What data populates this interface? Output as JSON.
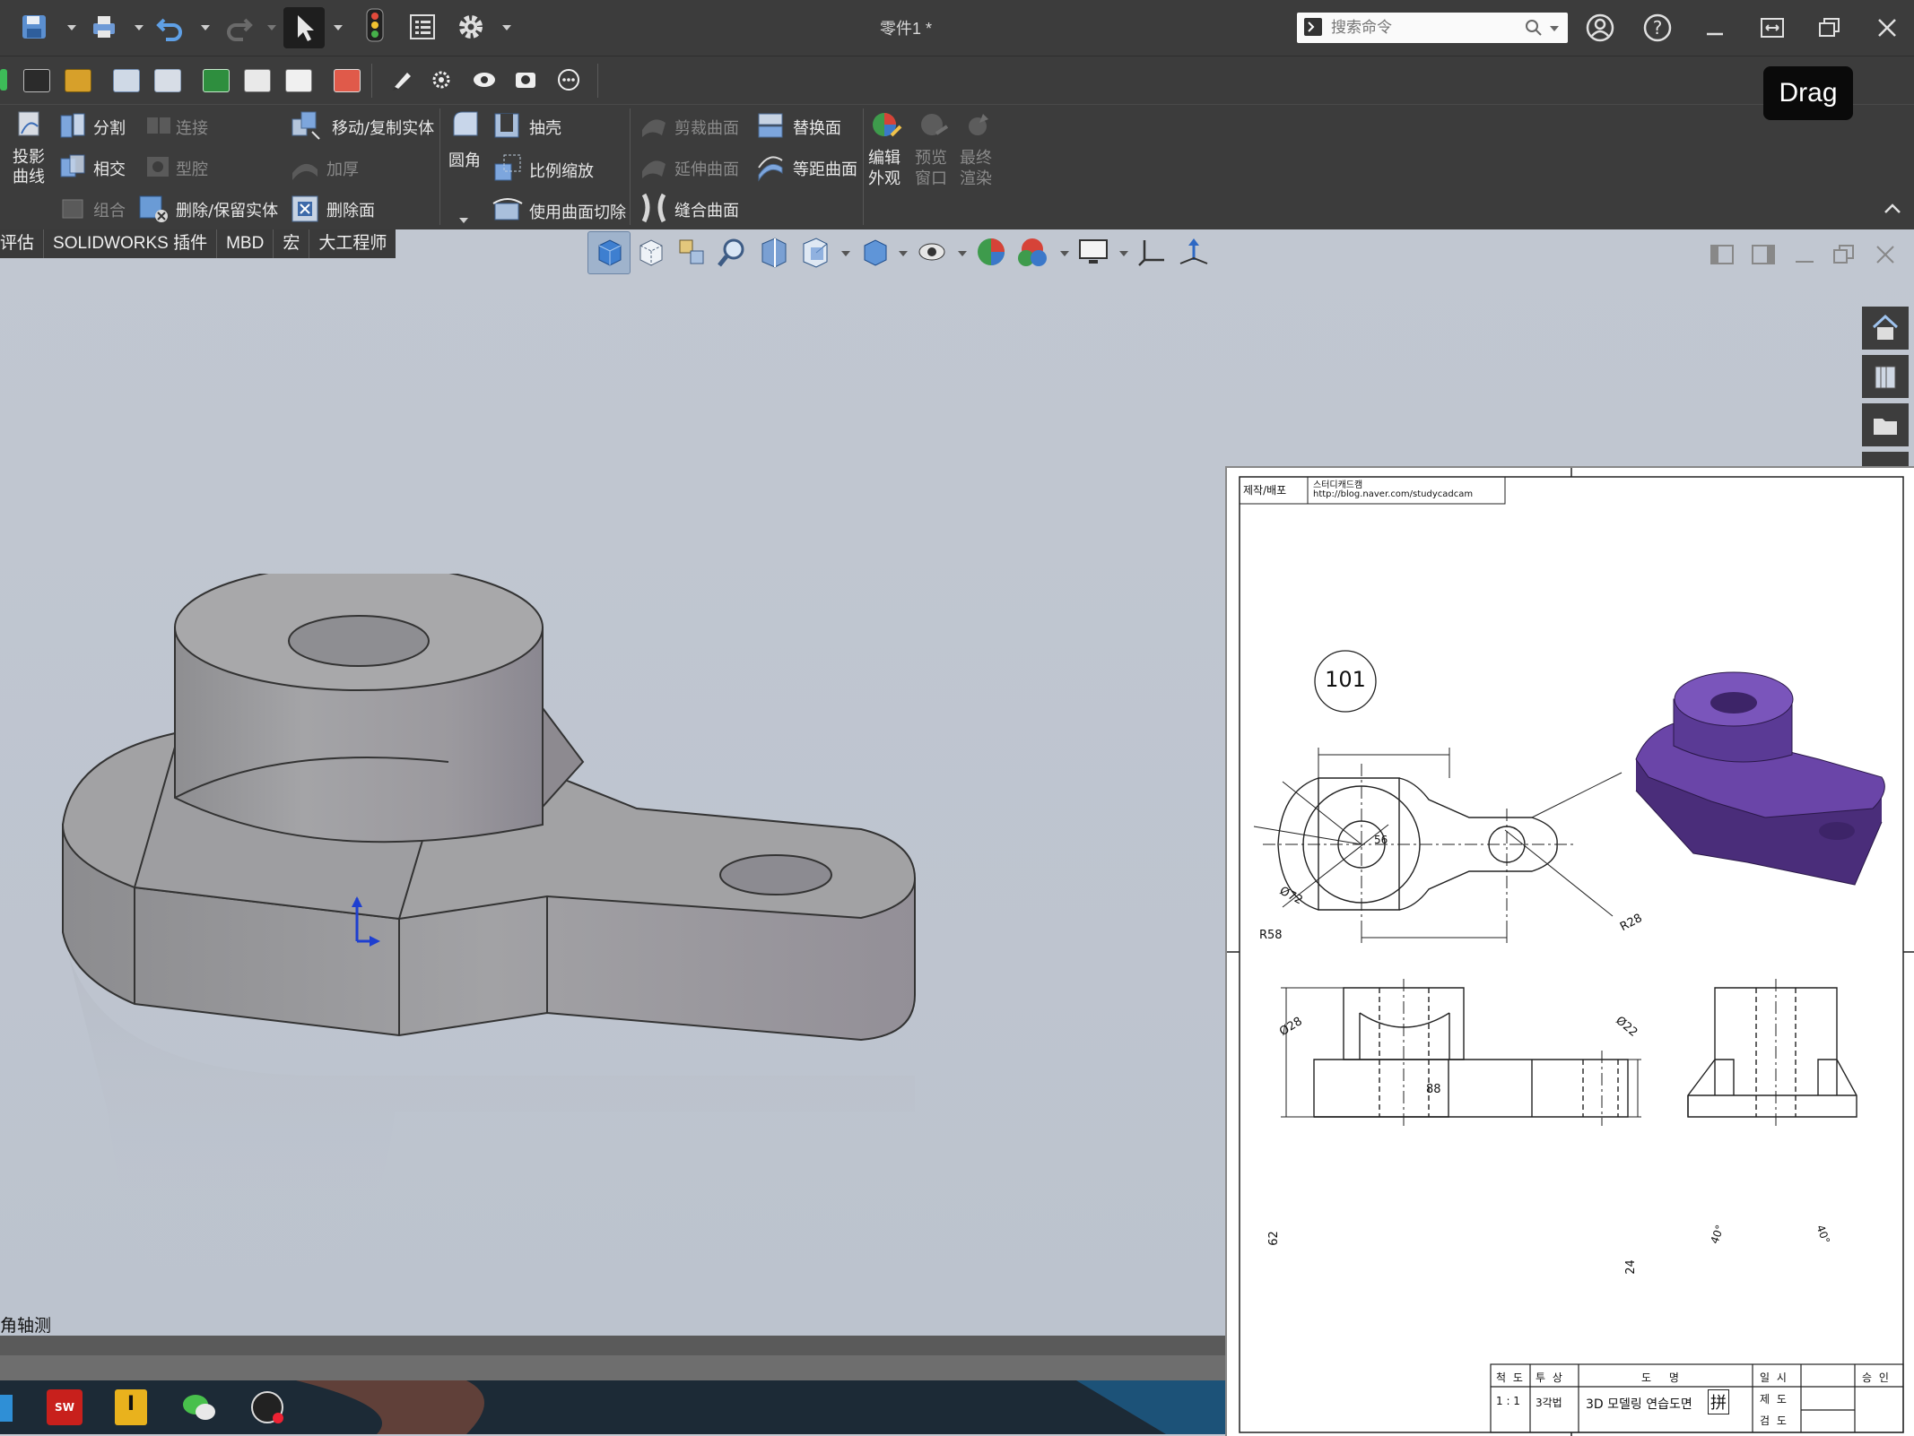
{
  "app": {
    "document_title": "零件1 *",
    "search_placeholder": "搜索命令",
    "drag_label": "Drag"
  },
  "ribbon": {
    "buttons": {
      "projected_curve": "投影\n曲线",
      "split": "分割",
      "intersect": "相交",
      "combine": "组合",
      "join": "连接",
      "cavity": "型腔",
      "delete_keep_body": "删除/保留实体",
      "move_copy_body": "移动/复制实体",
      "thicken": "加厚",
      "delete_face": "删除面",
      "fillet": "圆角",
      "shell": "抽壳",
      "scale": "比例缩放",
      "surface_cut": "使用曲面切除",
      "trim_surface": "剪裁曲面",
      "extend_surface": "延伸曲面",
      "knit_surface": "缝合曲面",
      "replace_face": "替换面",
      "offset_surface": "等距曲面",
      "edit_appearance": "编辑\n外观",
      "preview_window": "预览\n窗口",
      "final_render": "最终\n渲染"
    }
  },
  "tabs": [
    "评估",
    "SOLIDWORKS 插件",
    "MBD",
    "宏",
    "大工程师"
  ],
  "viewport": {
    "view_label": "角轴测"
  },
  "drawing": {
    "header_left": "제작/배포",
    "header_name": "스터디캐드캠",
    "header_url": "http://blog.naver.com/studycadcam",
    "number": "101",
    "dims": {
      "d56": "56",
      "d72": "Ø72",
      "r58": "R58",
      "r28": "R28",
      "d28": "Ø28",
      "d22": "Ø22",
      "d88": "88",
      "d62": "62",
      "d24": "24",
      "a40a": "40°",
      "a40b": "40°"
    },
    "title_block": {
      "scale_label": "척 도",
      "scale_value": "1 : 1",
      "proj_label": "투 상",
      "proj_value": "3각법",
      "name_label": "도 명",
      "name_value": "3D 모델링 연습도면",
      "date_label": "일 시",
      "drawn_label": "제 도",
      "checked_label": "검 도",
      "approve_label": "승 인",
      "overlay_char": "拼"
    }
  },
  "colors": {
    "chrome_dark": "#3c3c3c",
    "viewport_bg": "#c1c7d1",
    "part_gray": "#9c9c9f",
    "part_purple": "#6a45a8",
    "dim_blue": "#1f4fa8"
  }
}
